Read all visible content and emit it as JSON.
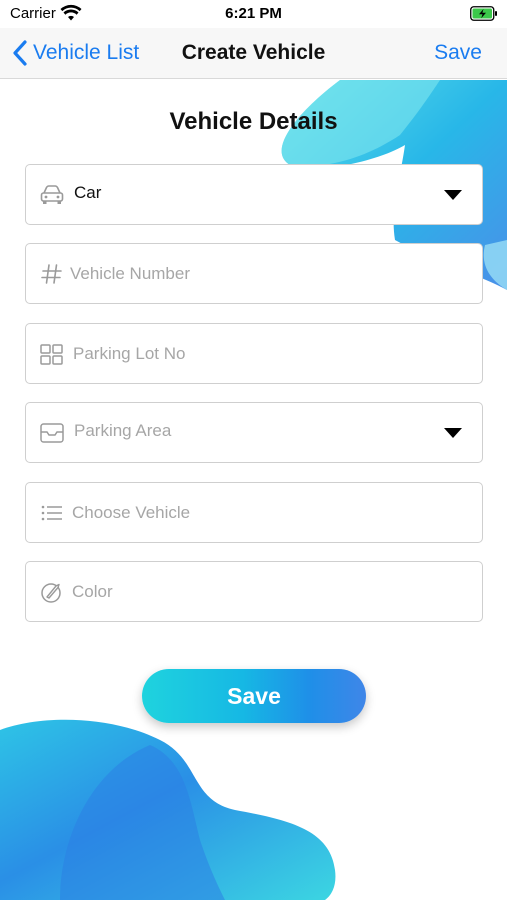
{
  "status_bar": {
    "carrier": "Carrier",
    "time": "6:21 PM",
    "wifi_icon": "wifi-icon",
    "battery_icon": "battery-charging-icon"
  },
  "nav": {
    "back_label": "Vehicle List",
    "title": "Create Vehicle",
    "save_label": "Save"
  },
  "form": {
    "title": "Vehicle Details",
    "vehicle_type": {
      "value": "Car",
      "icon": "car-icon",
      "options_selected": "Car"
    },
    "vehicle_number": {
      "placeholder": "Vehicle Number",
      "icon": "hash-icon"
    },
    "parking_lot": {
      "placeholder": "Parking Lot No",
      "icon": "grid-icon"
    },
    "parking_area": {
      "placeholder": "Parking Area",
      "icon": "inbox-icon"
    },
    "choose_vehicle": {
      "placeholder": "Choose Vehicle",
      "icon": "list-icon"
    },
    "color": {
      "placeholder": "Color",
      "icon": "color-picker-icon"
    }
  },
  "save_button": {
    "label": "Save"
  },
  "colors": {
    "accent": "#1a7cf0",
    "gradient_start": "#1fd3de",
    "gradient_end": "#3f86e8",
    "field_border": "#cfcfcf",
    "placeholder": "#a6a6a6"
  }
}
